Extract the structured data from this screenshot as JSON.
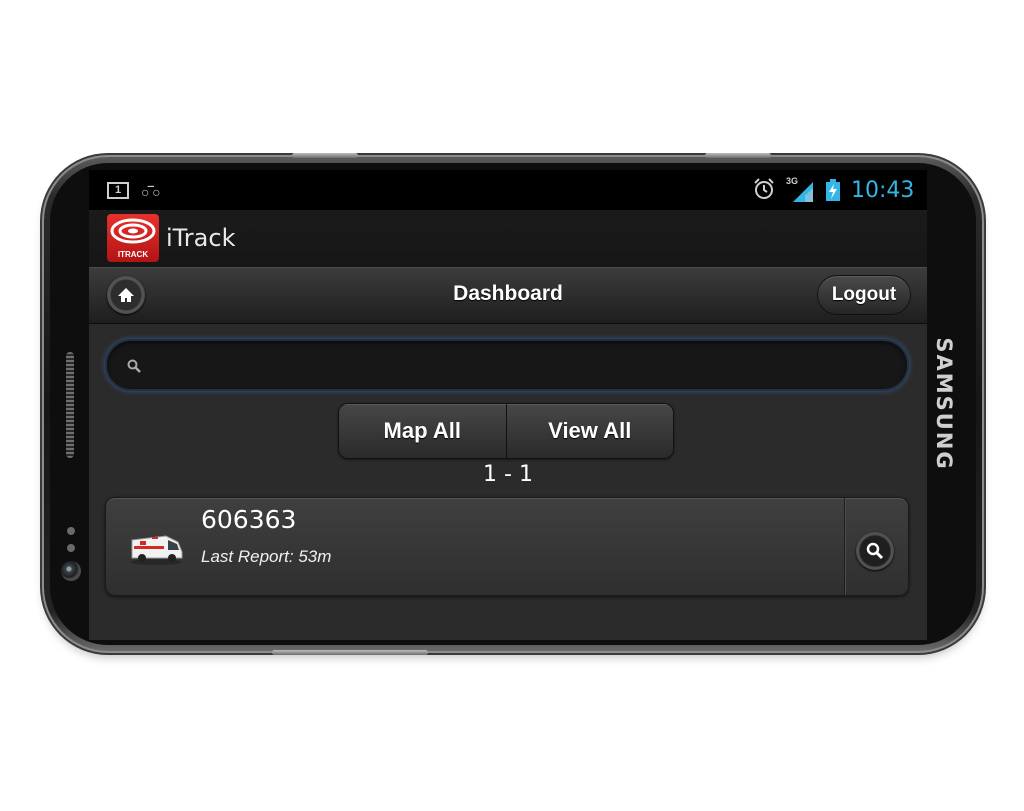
{
  "status_bar": {
    "notification_count": "1",
    "voicemail_icon": "voicemail-icon",
    "alarm_icon": "alarm-icon",
    "network": "3G",
    "signal_icon": "signal-icon",
    "battery_icon": "battery-charging-icon",
    "time": "10:43",
    "time_color": "#33b5e5"
  },
  "app": {
    "logo_text": "ITRACK",
    "title": "iTrack",
    "brand_color": "#d52a22"
  },
  "header": {
    "home_icon": "home-icon",
    "title": "Dashboard",
    "logout_label": "Logout"
  },
  "search": {
    "icon": "search-icon",
    "value": "",
    "placeholder": ""
  },
  "actions": {
    "map_all_label": "Map All",
    "view_all_label": "View All"
  },
  "pager": {
    "range": "1 - 1"
  },
  "vehicles": [
    {
      "icon": "ambulance-icon",
      "id": "606363",
      "last_report": "Last Report: 53m",
      "detail_icon": "search-icon"
    }
  ],
  "device": {
    "brand": "SAMSUNG"
  }
}
